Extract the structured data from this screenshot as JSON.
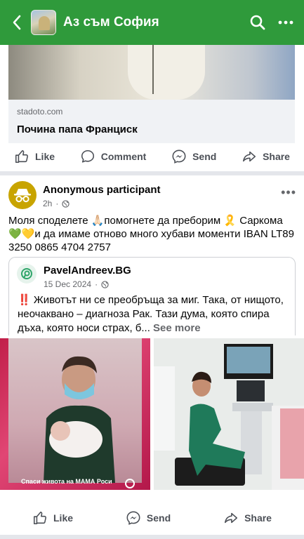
{
  "topbar": {
    "title": "Аз съм София",
    "bg_color": "#2f9a3b"
  },
  "link_preview": {
    "domain": "stadoto.com",
    "title": "Почина папа Франциск"
  },
  "actions_top": {
    "like": "Like",
    "comment": "Comment",
    "send": "Send",
    "share": "Share"
  },
  "post": {
    "author": "Anonymous participant",
    "time": "2h",
    "text": "Моля споделете 🙏🏻помогнете да преборим 🎗️ Саркома 💚💛и да имаме отново много хубави моменти IBAN    LT89 3250 0865 4704 2757",
    "shared": {
      "author": "PavelAndreev.BG",
      "date": "15 Dec 2024",
      "text": "‼️ Животът ни се преобръща за миг. Така, от нищото, неочаквано – диагноза Рак. Тази дума, която спира дъха, която носи страх, б...",
      "see_more": "See more"
    },
    "photo_caption": "Спаси живота на МАМА Роси"
  },
  "actions_bottom": {
    "like": "Like",
    "send": "Send",
    "share": "Share"
  }
}
